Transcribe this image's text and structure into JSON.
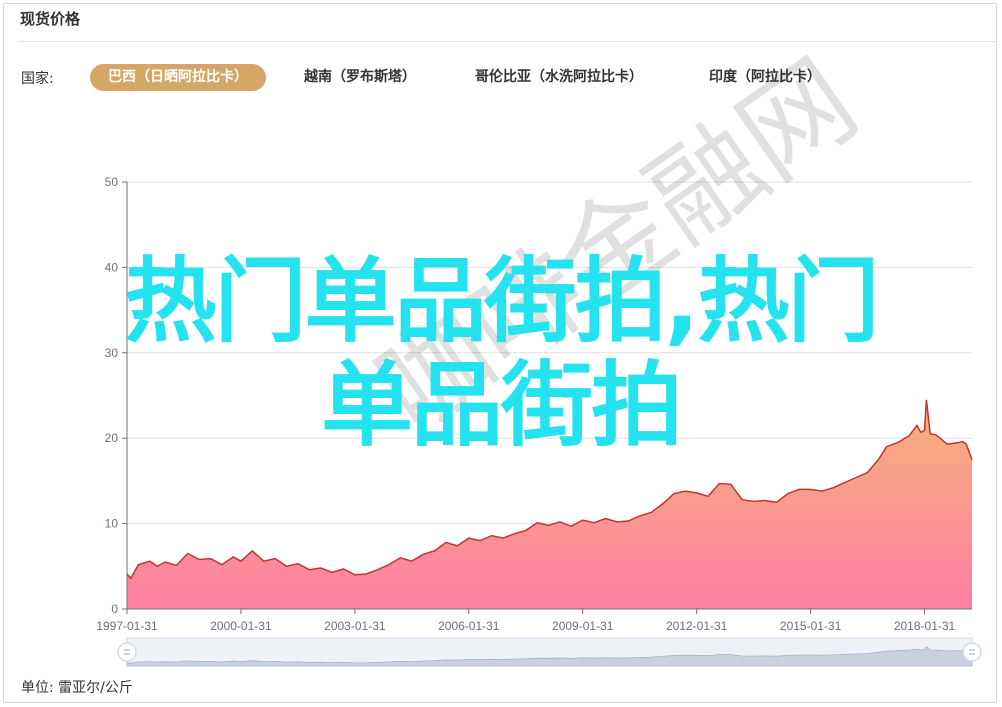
{
  "header": {
    "title": "现货价格"
  },
  "filter": {
    "label": "国家:",
    "tabs": [
      {
        "label": "巴西（日晒阿拉比卡）",
        "active": true
      },
      {
        "label": "越南（罗布斯塔）",
        "active": false
      },
      {
        "label": "哥伦比亚（水洗阿拉比卡）",
        "active": false
      },
      {
        "label": "印度（阿拉比卡）",
        "active": false
      }
    ]
  },
  "overlay": {
    "line1": "热门单品街拍,热门",
    "line2": "单品街拍"
  },
  "watermark": {
    "text": "咖啡金融网"
  },
  "footer": {
    "unit": "单位: 雷亚尔/公斤"
  },
  "colors": {
    "accent": "#d4a767",
    "line": "#c23531",
    "area_top": "#f5b27a",
    "area_bottom": "#ff7fa3",
    "overlay": "#25e3ee"
  },
  "chart_data": {
    "type": "area",
    "ylim": [
      0,
      50
    ],
    "yticks": [
      0,
      10,
      20,
      30,
      40,
      50
    ],
    "xlim": [
      1997.0,
      2019.25
    ],
    "xticks": [
      {
        "x": 1997.0,
        "label": "1997-01-31"
      },
      {
        "x": 2000.0,
        "label": "2000-01-31"
      },
      {
        "x": 2003.0,
        "label": "2003-01-31"
      },
      {
        "x": 2006.0,
        "label": "2006-01-31"
      },
      {
        "x": 2009.0,
        "label": "2009-01-31"
      },
      {
        "x": 2012.0,
        "label": "2012-01-31"
      },
      {
        "x": 2015.0,
        "label": "2015-01-31"
      },
      {
        "x": 2018.0,
        "label": "2018-01-31"
      }
    ],
    "points": [
      [
        1997.0,
        4.1
      ],
      [
        1997.1,
        3.6
      ],
      [
        1997.3,
        5.2
      ],
      [
        1997.6,
        5.6
      ],
      [
        1997.8,
        5.0
      ],
      [
        1998.0,
        5.5
      ],
      [
        1998.3,
        5.1
      ],
      [
        1998.6,
        6.5
      ],
      [
        1998.9,
        5.8
      ],
      [
        1999.2,
        5.9
      ],
      [
        1999.5,
        5.2
      ],
      [
        1999.8,
        6.1
      ],
      [
        2000.0,
        5.6
      ],
      [
        2000.3,
        6.8
      ],
      [
        2000.6,
        5.6
      ],
      [
        2000.9,
        5.9
      ],
      [
        2001.2,
        5.0
      ],
      [
        2001.5,
        5.3
      ],
      [
        2001.8,
        4.6
      ],
      [
        2002.1,
        4.8
      ],
      [
        2002.4,
        4.3
      ],
      [
        2002.7,
        4.7
      ],
      [
        2003.0,
        4.0
      ],
      [
        2003.3,
        4.1
      ],
      [
        2003.6,
        4.6
      ],
      [
        2003.9,
        5.2
      ],
      [
        2004.2,
        6.0
      ],
      [
        2004.5,
        5.6
      ],
      [
        2004.8,
        6.4
      ],
      [
        2005.1,
        6.8
      ],
      [
        2005.4,
        7.8
      ],
      [
        2005.7,
        7.4
      ],
      [
        2006.0,
        8.3
      ],
      [
        2006.3,
        8.0
      ],
      [
        2006.6,
        8.6
      ],
      [
        2006.9,
        8.3
      ],
      [
        2007.2,
        8.8
      ],
      [
        2007.5,
        9.2
      ],
      [
        2007.8,
        10.1
      ],
      [
        2008.1,
        9.8
      ],
      [
        2008.4,
        10.2
      ],
      [
        2008.7,
        9.7
      ],
      [
        2009.0,
        10.4
      ],
      [
        2009.3,
        10.1
      ],
      [
        2009.6,
        10.6
      ],
      [
        2009.9,
        10.2
      ],
      [
        2010.2,
        10.3
      ],
      [
        2010.5,
        10.9
      ],
      [
        2010.8,
        11.3
      ],
      [
        2011.1,
        12.3
      ],
      [
        2011.4,
        13.5
      ],
      [
        2011.7,
        13.8
      ],
      [
        2012.0,
        13.6
      ],
      [
        2012.3,
        13.2
      ],
      [
        2012.6,
        14.7
      ],
      [
        2012.9,
        14.6
      ],
      [
        2013.2,
        12.8
      ],
      [
        2013.5,
        12.6
      ],
      [
        2013.8,
        12.7
      ],
      [
        2014.1,
        12.5
      ],
      [
        2014.4,
        13.5
      ],
      [
        2014.7,
        14.0
      ],
      [
        2015.0,
        14.0
      ],
      [
        2015.3,
        13.8
      ],
      [
        2015.6,
        14.2
      ],
      [
        2015.9,
        14.8
      ],
      [
        2016.2,
        15.4
      ],
      [
        2016.5,
        16.0
      ],
      [
        2016.8,
        17.6
      ],
      [
        2017.0,
        19.0
      ],
      [
        2017.3,
        19.5
      ],
      [
        2017.6,
        20.3
      ],
      [
        2017.8,
        21.5
      ],
      [
        2017.9,
        20.7
      ],
      [
        2018.0,
        20.9
      ],
      [
        2018.05,
        24.5
      ],
      [
        2018.15,
        20.5
      ],
      [
        2018.3,
        20.4
      ],
      [
        2018.6,
        19.3
      ],
      [
        2018.9,
        19.5
      ],
      [
        2019.0,
        19.6
      ],
      [
        2019.1,
        19.3
      ],
      [
        2019.25,
        17.5
      ]
    ]
  }
}
